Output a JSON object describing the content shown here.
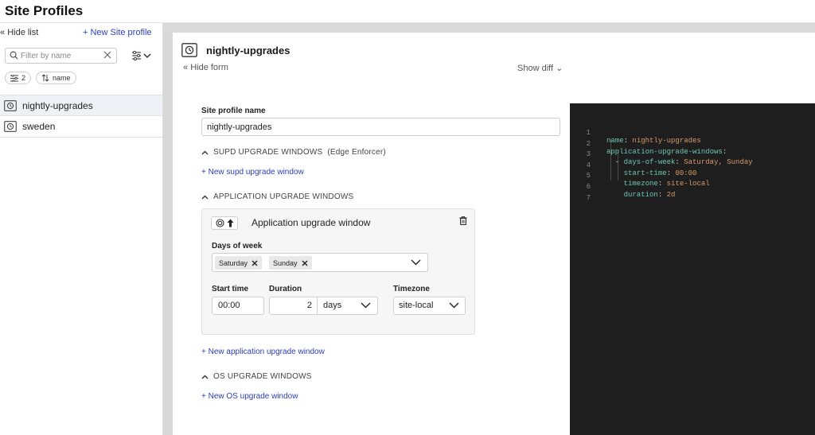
{
  "app": {
    "title": "Site Profiles"
  },
  "sidebar": {
    "hide_list": "Hide list",
    "new_site_profile": "+ New Site profile",
    "filter_placeholder": "Filter by name",
    "chips": {
      "filter_count": "2",
      "sort": "name"
    },
    "items": [
      {
        "label": "nightly-upgrades",
        "active": true
      },
      {
        "label": "sweden",
        "active": false
      }
    ]
  },
  "panel": {
    "title": "nightly-upgrades",
    "hide_form": "Hide form",
    "show_diff": "Show diff"
  },
  "form": {
    "name_label": "Site profile name",
    "name_value": "nightly-upgrades",
    "supd_section": "SUPD UPGRADE WINDOWS",
    "supd_section_note": "(Edge Enforcer)",
    "new_supd": "+ New supd upgrade window",
    "app_section": "APPLICATION UPGRADE WINDOWS",
    "app_window": {
      "title": "Application upgrade window",
      "days_label": "Days of week",
      "days": [
        "Saturday",
        "Sunday"
      ],
      "start_label": "Start time",
      "start_value": "00:00",
      "duration_label": "Duration",
      "duration_value": "2",
      "duration_unit": "days",
      "timezone_label": "Timezone",
      "timezone_value": "site-local"
    },
    "new_app": "+ New application upgrade window",
    "os_section": "OS UPGRADE WINDOWS",
    "new_os": "+ New OS upgrade window"
  },
  "editor": {
    "lines": [
      {
        "n": "1",
        "key": "name",
        "sep": ": ",
        "val": "nightly-upgrades",
        "indent": ""
      },
      {
        "n": "2",
        "key": "application-upgrade-windows",
        "sep": ":",
        "val": "",
        "indent": ""
      },
      {
        "n": "3",
        "key": "days-of-week",
        "sep": ": ",
        "val": "Saturday, Sunday",
        "indent": "  - "
      },
      {
        "n": "4",
        "key": "start-time",
        "sep": ": ",
        "val": "00:00",
        "indent": "    "
      },
      {
        "n": "5",
        "key": "timezone",
        "sep": ": ",
        "val": "site-local",
        "indent": "    "
      },
      {
        "n": "6",
        "key": "duration",
        "sep": ": ",
        "val": "2d",
        "indent": "    "
      },
      {
        "n": "7",
        "key": "",
        "sep": "",
        "val": "",
        "indent": ""
      }
    ]
  }
}
